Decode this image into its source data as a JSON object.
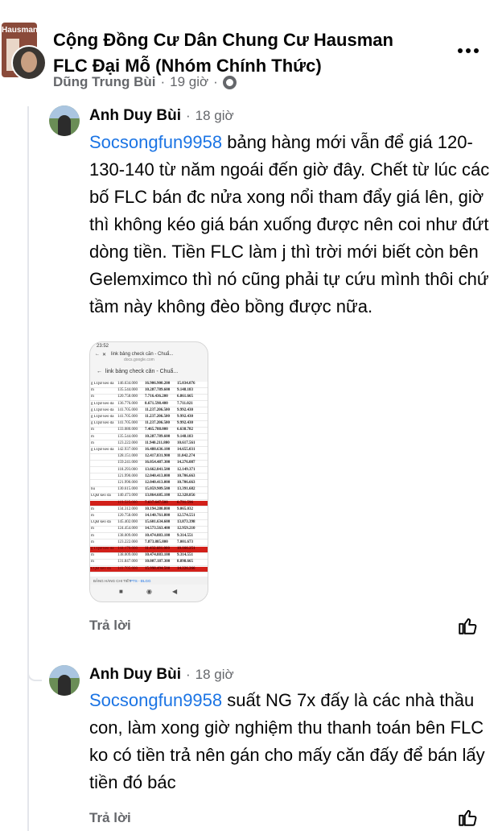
{
  "post": {
    "group_title": "Cộng Đồng Cư Dân Chung Cư Hausman FLC Đại Mỗ (Nhóm Chính Thức)",
    "group_avatar_text": "Hausman",
    "author": "Dũng Trung Bùi",
    "time": "19 giờ",
    "separator": "·",
    "privacy_icon": "globe-icon",
    "more_icon": "more-dots-icon"
  },
  "comments": [
    {
      "author": "Anh Duy Bùi",
      "time": "18 giờ",
      "mention": "Socsongfun9958",
      "text": " bảng hàng mới vẫn để giá 120-130-140 từ năm ngoái đến giờ đây. Chết từ lúc các bố FLC bán đc nửa xong nổi tham đẩy giá lên, giờ thì không kéo giá bán xuống được nên coi như đứt dòng tiền. Tiền FLC làm j thì trời mới biết còn bên Gelemximco thì nó cũng phải tự cứu mình thôi chứ tầm này không đèo bồng được nữa.",
      "reply_label": "Trả lời",
      "like_icon": "thumbs-up-icon"
    },
    {
      "author": "Anh Duy Bùi",
      "time": "18 giờ",
      "mention": "Socsongfun9958",
      "text": " suất NG 7x đấy là các nhà thầu con, làm xong giờ nghiệm thu thanh toán bên FLC ko có tiền trả nên gán cho mấy căn đấy để bán lấy tiền đó bác",
      "reply_label": "Trả lời",
      "like_icon": "thumbs-up-icon"
    }
  ],
  "attachment": {
    "status_time": "23:52",
    "browser_title": "link bảng check căn - Chuẩ...",
    "browser_domain": "docs.google.com",
    "doc_title": "link bảng check căn - Chuẩ...",
    "tabs": [
      "BẢNG HÀNG CHI TIẾT",
      "PTS - ĐLGG"
    ],
    "nav_icons": [
      "■",
      "◉",
      "◀"
    ],
    "rows": [
      {
        "c1": "g LQĐ kéo đá",
        "c2": "146.634.000",
        "c3": "16.906.900.200",
        "c4": "15.034.076",
        "red": false
      },
      {
        "c1": "m",
        "c2": "135.544.000",
        "c3": "10.287.789.600",
        "c4": "9.148.183",
        "red": false
      },
      {
        "c1": "m",
        "c2": "120.758.000",
        "c3": "7.716.436.200",
        "c4": "6.861.665",
        "red": false
      },
      {
        "c1": "g LQĐ kéo đá",
        "c2": "136.776.000",
        "c3": "8.671.598.400",
        "c4": "7.711.021",
        "red": false
      },
      {
        "c1": "g LQĐ kéo đá",
        "c2": "141.705.000",
        "c3": "11.237.206.500",
        "c4": "9.992.430",
        "red": false
      },
      {
        "c1": "g LQĐ kéo đá",
        "c2": "141.705.000",
        "c3": "11.237.206.500",
        "c4": "9.992.430",
        "red": false
      },
      {
        "c1": "g LQĐ kéo đá",
        "c2": "141.705.000",
        "c3": "11.237.206.500",
        "c4": "9.992.430",
        "red": false
      },
      {
        "c1": "m",
        "c2": "133.080.000",
        "c3": "7.465.788.000",
        "c4": "6.638.782",
        "red": false
      },
      {
        "c1": "m",
        "c2": "135.544.000",
        "c3": "10.287.789.600",
        "c4": "9.148.183",
        "red": false
      },
      {
        "c1": "m",
        "c2": "123.222.000",
        "c3": "11.940.211.800",
        "c4": "10.617.561",
        "red": false
      },
      {
        "c1": "g LQĐ kéo đá",
        "c2": "142.937.000",
        "c3": "16.488.636.100",
        "c4": "14.655.031",
        "red": false
      },
      {
        "c1": "",
        "c2": "128.151.000",
        "c3": "12.417.831.900",
        "c4": "11.042.274",
        "red": false
      },
      {
        "c1": "",
        "c2": "159.241.000",
        "c3": "16.054.487.300",
        "c4": "14.276.087",
        "red": false
      },
      {
        "c1": "",
        "c2": "118.293.000",
        "c3": "13.662.841.500",
        "c4": "12.149.371",
        "red": false
      },
      {
        "c1": "",
        "c2": "121.990.000",
        "c3": "12.040.413.000",
        "c4": "10.706.663",
        "red": false
      },
      {
        "c1": "",
        "c2": "121.990.000",
        "c3": "12.040.413.000",
        "c4": "10.706.663",
        "red": false
      },
      {
        "c1": "hu",
        "c2": "130.615.000",
        "c3": "15.059.909.500",
        "c4": "13.391.682",
        "red": false
      },
      {
        "c1": "LQĐ kéo đá",
        "c2": "140.473.000",
        "c3": "13.864.685.100",
        "c4": "12.328.856",
        "red": false
      },
      {
        "c1": "",
        "c2": "119.525.000",
        "c3": "7.637.647.500",
        "c4": "6.791.596",
        "red": true
      },
      {
        "c1": "m",
        "c2": "134.312.000",
        "c3": "10.194.280.800",
        "c4": "9.065.032",
        "red": false
      },
      {
        "c1": "m",
        "c2": "120.758.000",
        "c3": "14.140.761.800",
        "c4": "12.574.551",
        "red": false
      },
      {
        "c1": "LQĐ kéo đá",
        "c2": "145.402.000",
        "c3": "15.601.634.600",
        "c4": "13.873.398",
        "red": false
      },
      {
        "c1": "m",
        "c2": "124.454.000",
        "c3": "14.573.563.400",
        "c4": "12.959.210",
        "red": false
      },
      {
        "c1": "m",
        "c2": "138.009.000",
        "c3": "10.474.883.100",
        "c4": "9.314.551",
        "red": false
      },
      {
        "c1": "m",
        "c2": "123.222.000",
        "c3": "7.873.885.800",
        "c4": "7.001.673",
        "red": false
      },
      {
        "c1": "g LQĐ kéo đá",
        "c2": "144.170.000",
        "c3": "11.432.681.000",
        "c4": "10.166.251",
        "red": true
      },
      {
        "c1": "m",
        "c2": "138.009.000",
        "c3": "10.474.883.100",
        "c4": "9.314.551",
        "red": false
      },
      {
        "c1": "m",
        "c2": "131.847.000",
        "c3": "10.007.187.300",
        "c4": "8.898.665",
        "red": false
      },
      {
        "c1": "LQĐ kéo đá",
        "c2": "141.705.000",
        "c3": "15.998.494.500",
        "c4": "14.226.266",
        "red": true
      }
    ]
  }
}
